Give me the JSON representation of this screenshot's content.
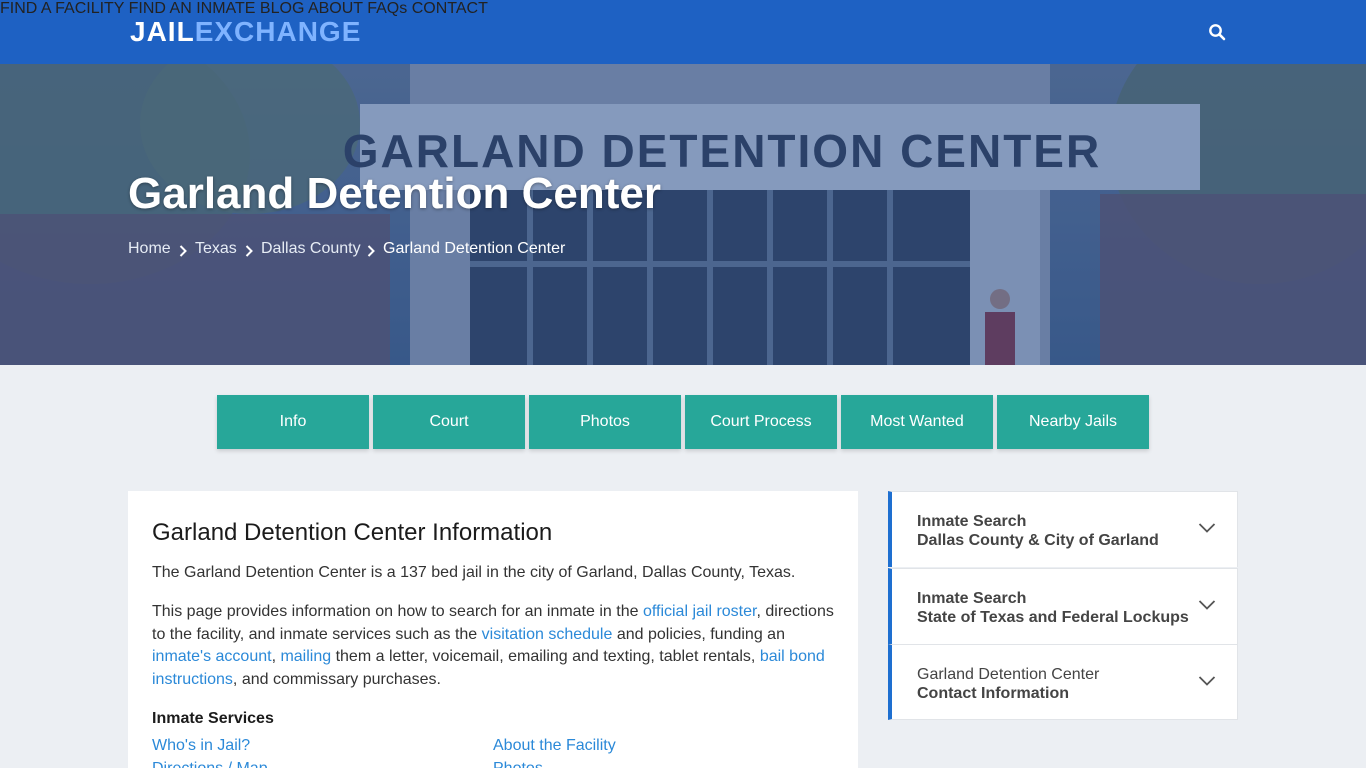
{
  "header": {
    "logo_part1": "JAIL",
    "logo_part2": "EXCHANGE",
    "nav": [
      "FIND A FACILITY",
      "FIND AN INMATE",
      "BLOG",
      "ABOUT",
      "FAQs",
      "CONTACT"
    ],
    "search_icon": "search-icon"
  },
  "hero": {
    "title": "Garland Detention Center",
    "breadcrumbs": [
      "Home",
      "Texas",
      "Dallas County",
      "Garland Detention Center"
    ],
    "sign_text": "GARLAND DETENTION CENTER"
  },
  "tabs": [
    "Info",
    "Court",
    "Photos",
    "Court Process",
    "Most Wanted",
    "Nearby Jails"
  ],
  "main": {
    "heading": "Garland Detention Center Information",
    "intro": "The Garland Detention Center is a 137 bed jail in the city of Garland, Dallas County, Texas.",
    "p2": {
      "t1": "This page provides information on how to search for an inmate in the ",
      "link_roster": "official jail roster",
      "t2": ", directions to the facility, and inmate services such as the ",
      "link_visitation": "visitation schedule",
      "t3": " and policies, funding an ",
      "link_account": "inmate's account",
      "t4": ", ",
      "link_mailing": "mailing",
      "t5": " them a letter, voicemail, emailing and texting, tablet rentals, ",
      "link_bail": "bail bond instructions",
      "t6": ", and commissary purchases."
    },
    "services_heading": "Inmate Services",
    "services": [
      "Who's in Jail?",
      "About the Facility",
      "Directions / Map",
      "Photos"
    ]
  },
  "sidebar": [
    {
      "line1": "Inmate Search",
      "line2": "Dallas County & City of Garland"
    },
    {
      "line1": "Inmate Search",
      "line2": "State of Texas and Federal Lockups"
    },
    {
      "line1": "Garland Detention Center",
      "line2": "Contact Information"
    }
  ],
  "colors": {
    "header_blue": "#1e61c3",
    "tab_teal": "#27a799",
    "link_blue": "#2b89d8",
    "accent_border": "#1e6fd0"
  }
}
